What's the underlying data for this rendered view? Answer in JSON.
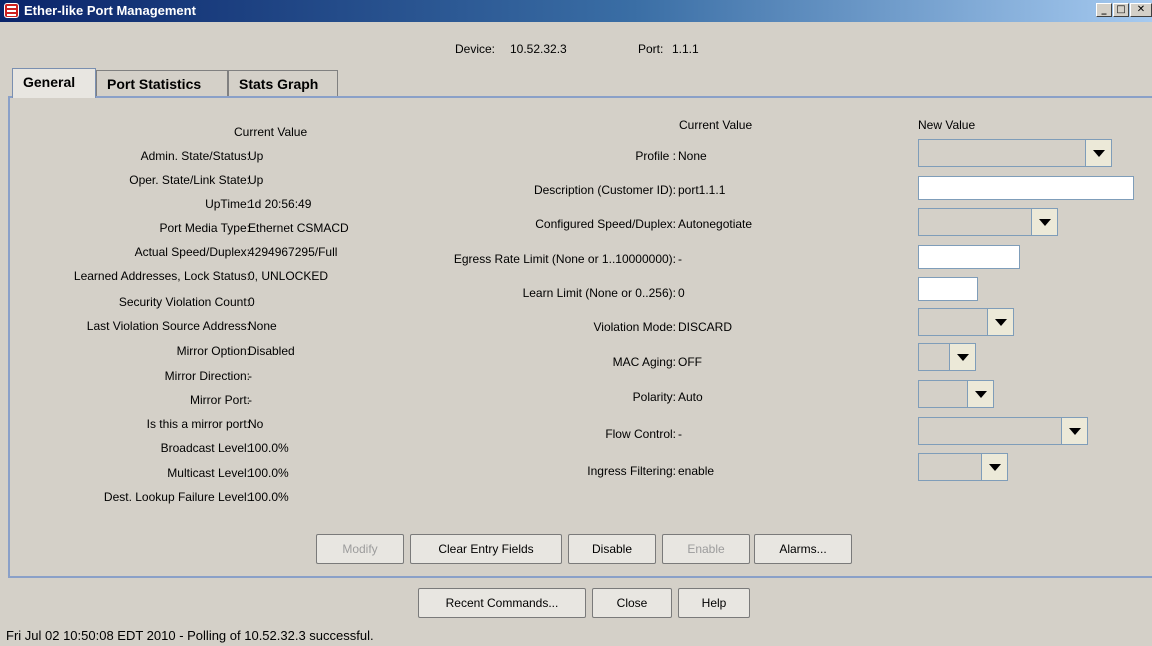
{
  "window": {
    "title": "Ether-like Port Management"
  },
  "device": {
    "label": "Device:",
    "value": "10.52.32.3",
    "port_label": "Port:",
    "port_value": "1.1.1"
  },
  "tabs": [
    {
      "label": "General",
      "active": true
    },
    {
      "label": "Port Statistics",
      "active": false
    },
    {
      "label": "Stats Graph",
      "active": false
    }
  ],
  "left": {
    "header": "Current Value",
    "rows": [
      {
        "label": "Admin. State/Status:",
        "value": "Up"
      },
      {
        "label": "Oper. State/Link State:",
        "value": "Up"
      },
      {
        "label": "UpTime:",
        "value": "1d 20:56:49"
      },
      {
        "label": "Port Media Type:",
        "value": "Ethernet CSMACD"
      },
      {
        "label": "Actual Speed/Duplex:",
        "value": "4294967295/Full"
      },
      {
        "label": "Learned Addresses, Lock Status:",
        "value": "0, UNLOCKED"
      },
      {
        "label": "Security Violation Count:",
        "value": "0"
      },
      {
        "label": "Last Violation Source Address:",
        "value": "None"
      },
      {
        "label": "Mirror Option:",
        "value": "Disabled"
      },
      {
        "label": "Mirror Direction:",
        "value": "-"
      },
      {
        "label": "Mirror Port:",
        "value": "-"
      },
      {
        "label": "Is this a mirror port:",
        "value": "No"
      },
      {
        "label": "Broadcast Level:",
        "value": "100.0%"
      },
      {
        "label": "Multicast Level:",
        "value": "100.0%"
      },
      {
        "label": "Dest. Lookup Failure Level:",
        "value": "100.0%"
      }
    ]
  },
  "right": {
    "header_current": "Current Value",
    "header_new": "New Value",
    "rows": [
      {
        "label": "Profile :",
        "value": "None"
      },
      {
        "label": "Description (Customer ID):",
        "value": "port1.1.1"
      },
      {
        "label": "Configured Speed/Duplex:",
        "value": "Autonegotiate"
      },
      {
        "label": "Egress Rate Limit (None or 1..10000000):",
        "value": "-"
      },
      {
        "label": "Learn Limit (None or 0..256):",
        "value": "0"
      },
      {
        "label": "Violation Mode:",
        "value": "DISCARD"
      },
      {
        "label": "MAC Aging:",
        "value": "OFF"
      },
      {
        "label": "Polarity:",
        "value": "Auto"
      },
      {
        "label": "Flow Control:",
        "value": "-"
      },
      {
        "label": "Ingress Filtering:",
        "value": "enable"
      }
    ]
  },
  "buttons": {
    "modify": "Modify",
    "clear": "Clear Entry Fields",
    "disable": "Disable",
    "enable": "Enable",
    "alarms": "Alarms...",
    "recent": "Recent Commands...",
    "close": "Close",
    "help": "Help"
  },
  "status": {
    "text": "Fri Jul 02 10:50:08 EDT 2010 - Polling of 10.52.32.3 successful."
  },
  "colors": {
    "title_start": "#0a246a",
    "title_end": "#a6caf0",
    "panel_border": "#8aa0c8",
    "background": "#d4d0c8"
  }
}
